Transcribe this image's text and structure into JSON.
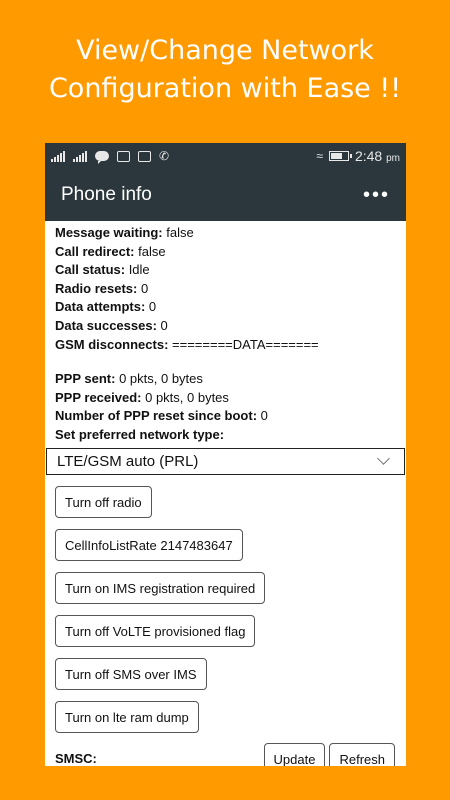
{
  "promo": {
    "line1": "View/Change Network",
    "line2": "Configuration with Ease !!"
  },
  "statusbar": {
    "time": "2:48",
    "ampm": "pm"
  },
  "appbar": {
    "title": "Phone info",
    "overflow": "•••"
  },
  "info": {
    "message_waiting": {
      "label": "Message waiting:",
      "value": " false"
    },
    "call_redirect": {
      "label": "Call redirect:",
      "value": " false"
    },
    "call_status": {
      "label": "Call status:",
      "value": " Idle"
    },
    "radio_resets": {
      "label": "Radio resets:",
      "value": " 0"
    },
    "data_attempts": {
      "label": "Data attempts:",
      "value": " 0"
    },
    "data_successes": {
      "label": "Data successes:",
      "value": " 0"
    },
    "gsm_disconnects": {
      "label": "GSM disconnects:",
      "value": " ========DATA======="
    },
    "ppp_sent": {
      "label": "PPP sent:",
      "value": " 0 pkts, 0 bytes"
    },
    "ppp_received": {
      "label": "PPP received:",
      "value": " 0 pkts, 0 bytes"
    },
    "ppp_reset": {
      "label": "Number of PPP reset since boot:",
      "value": " 0"
    },
    "pref_network_label": "Set preferred network type:"
  },
  "network_select": {
    "selected": "LTE/GSM auto (PRL)"
  },
  "buttons": {
    "radio": "Turn off radio",
    "cellinfo": "CellInfoListRate 2147483647",
    "ims_reg": "Turn on IMS registration required",
    "volte": "Turn off VoLTE provisioned flag",
    "sms_ims": "Turn off SMS over IMS",
    "lte_ram": "Turn on lte ram dump"
  },
  "smsc": {
    "label": "SMSC:",
    "update": "Update",
    "refresh": "Refresh"
  }
}
